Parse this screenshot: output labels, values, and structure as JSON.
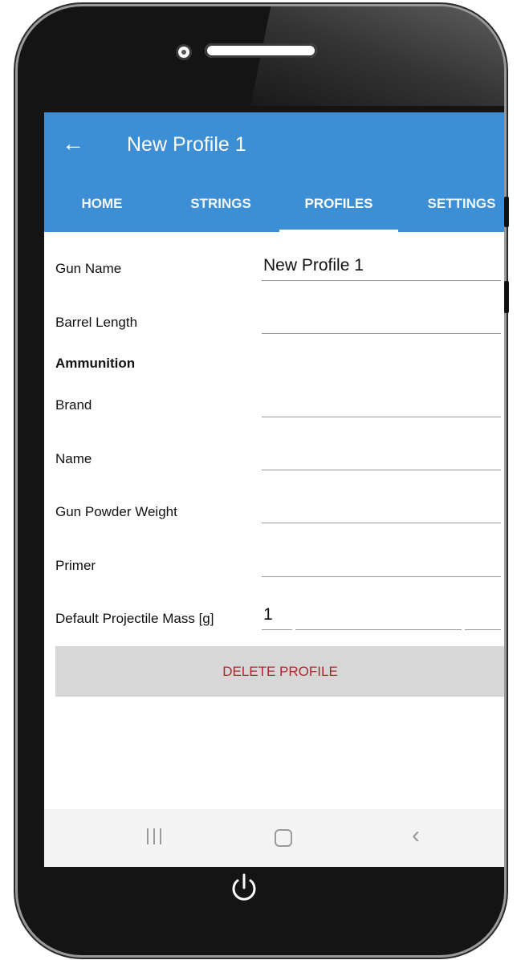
{
  "appbar": {
    "back_icon": "arrow-left-icon",
    "title": "New Profile 1",
    "color": "#3c8fd5"
  },
  "tabs": [
    {
      "label": "HOME",
      "active": false
    },
    {
      "label": "STRINGS",
      "active": false
    },
    {
      "label": "PROFILES",
      "active": true
    },
    {
      "label": "SETTINGS",
      "active": false
    }
  ],
  "form": {
    "gun_name": {
      "label": "Gun Name",
      "value": "New Profile 1"
    },
    "barrel_length": {
      "label": "Barrel Length",
      "value": ""
    },
    "section_ammunition": "Ammunition",
    "brand": {
      "label": "Brand",
      "value": ""
    },
    "name": {
      "label": "Name",
      "value": ""
    },
    "powder_weight": {
      "label": "Gun Powder Weight",
      "value": ""
    },
    "primer": {
      "label": "Primer",
      "value": ""
    },
    "projectile_mass": {
      "label": "Default Projectile Mass [g]",
      "value": "1"
    }
  },
  "actions": {
    "delete_label": "DELETE PROFILE",
    "delete_color": "#b3262e"
  },
  "navbar": {
    "recents_icon": "recents-icon",
    "home_icon": "home-icon",
    "back_icon": "chevron-left-icon"
  },
  "device": {
    "power_icon": "power-icon"
  }
}
